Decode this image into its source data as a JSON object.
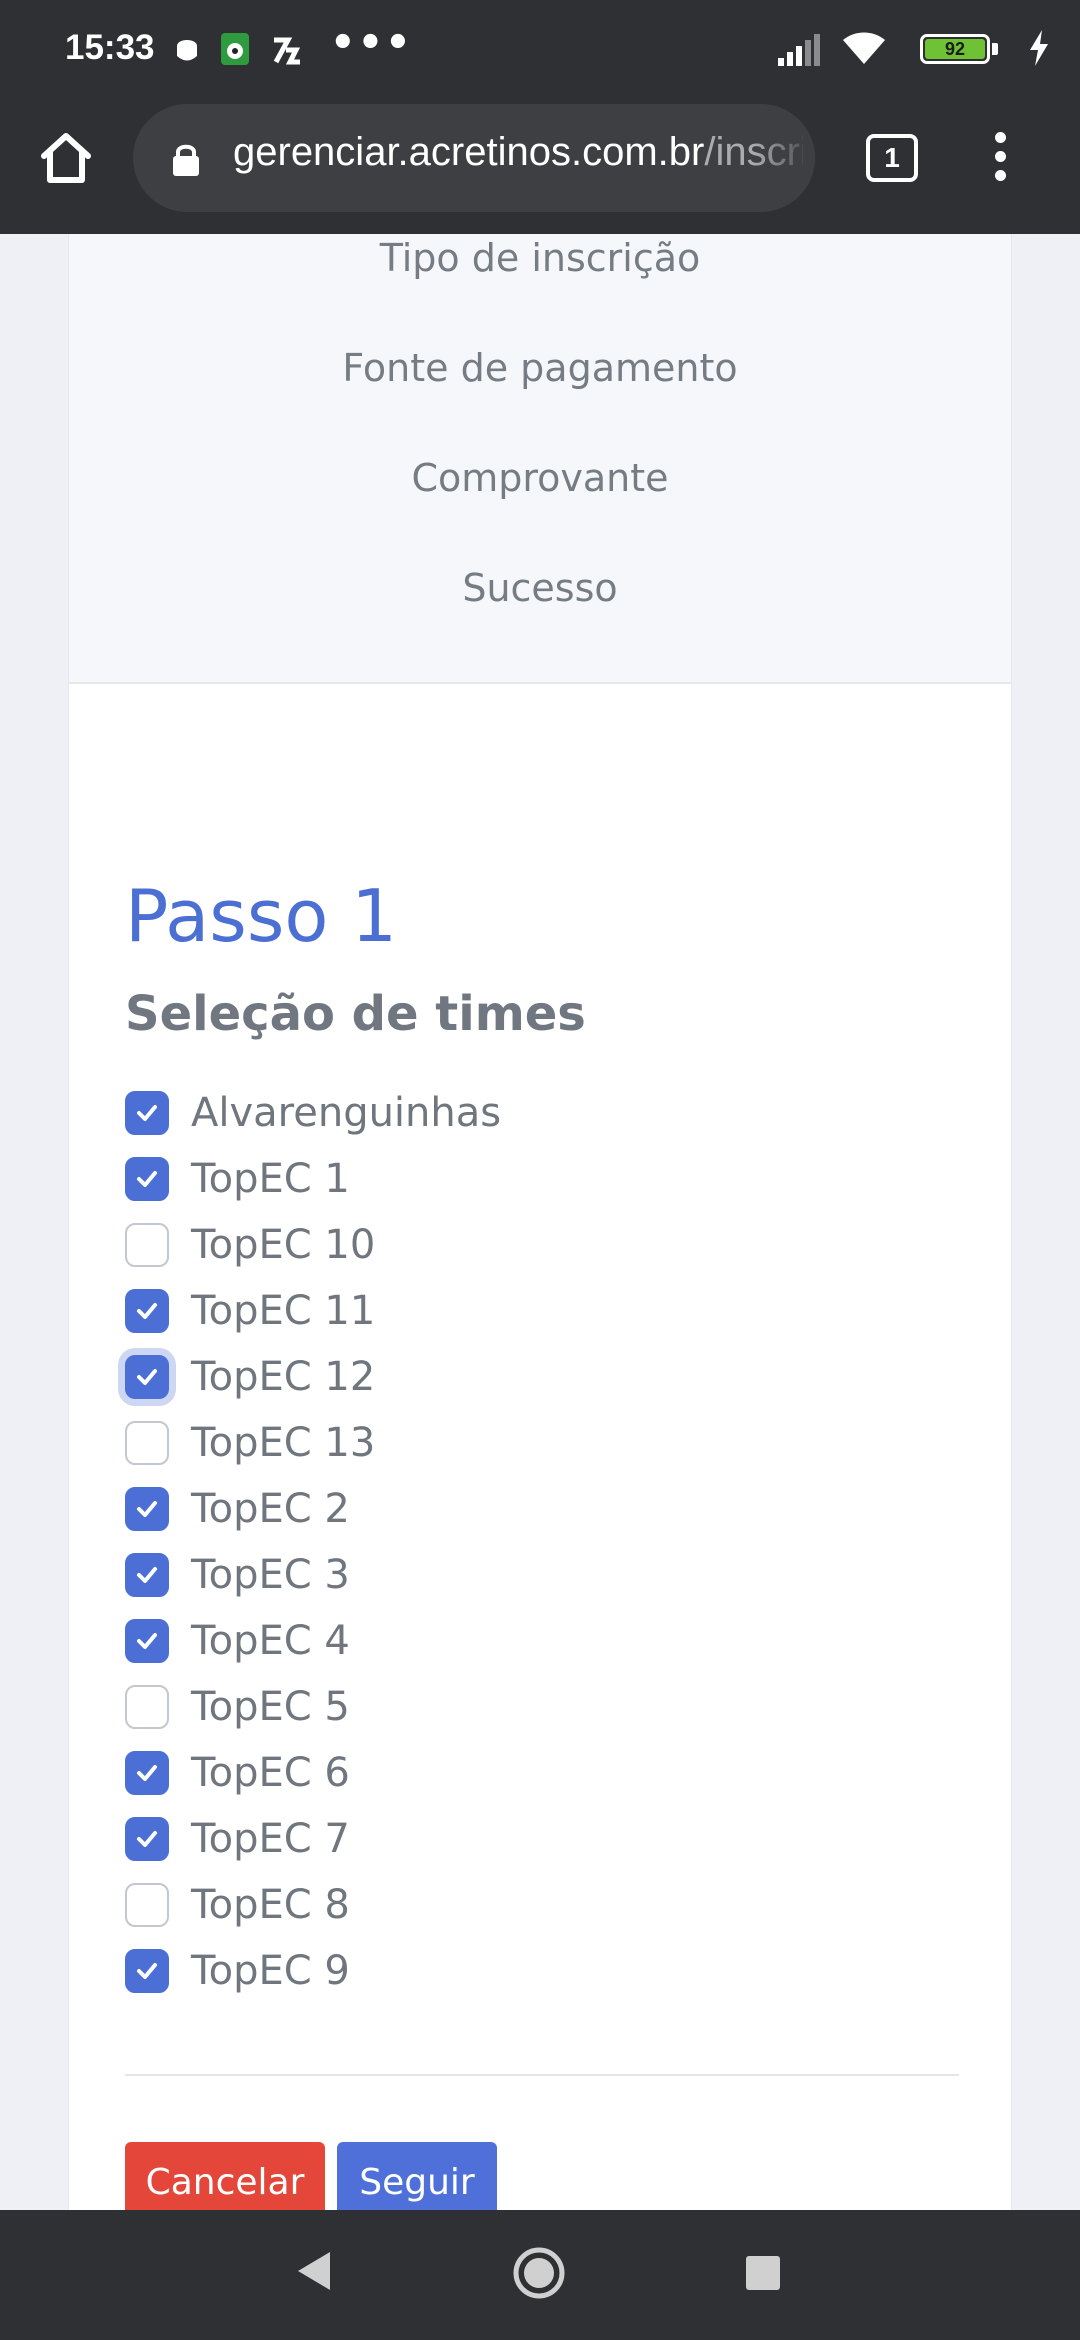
{
  "status_bar": {
    "time": "15:33",
    "overflow_dots": "•••",
    "battery_level": "92"
  },
  "browser": {
    "url_domain": "gerenciar.acretinos.com.br",
    "url_rest": "/inscricao",
    "tab_count": "1"
  },
  "steps": [
    "Tipo de inscrição",
    "Fonte de pagamento",
    "Comprovante",
    "Sucesso"
  ],
  "form": {
    "title": "Passo 1",
    "subtitle": "Seleção de times",
    "teams": [
      {
        "label": "Alvarenguinhas",
        "checked": true
      },
      {
        "label": "TopEC 1",
        "checked": true
      },
      {
        "label": "TopEC 10",
        "checked": false
      },
      {
        "label": "TopEC 11",
        "checked": true
      },
      {
        "label": "TopEC 12",
        "checked": true,
        "focused": true
      },
      {
        "label": "TopEC 13",
        "checked": false
      },
      {
        "label": "TopEC 2",
        "checked": true
      },
      {
        "label": "TopEC 3",
        "checked": true
      },
      {
        "label": "TopEC 4",
        "checked": true
      },
      {
        "label": "TopEC 5",
        "checked": false
      },
      {
        "label": "TopEC 6",
        "checked": true
      },
      {
        "label": "TopEC 7",
        "checked": true
      },
      {
        "label": "TopEC 8",
        "checked": false
      },
      {
        "label": "TopEC 9",
        "checked": true
      }
    ],
    "cancel_label": "Cancelar",
    "next_label": "Seguir"
  },
  "colors": {
    "primary": "#4c6fd6",
    "danger": "#e5463a",
    "system_bar": "#2f3034"
  }
}
